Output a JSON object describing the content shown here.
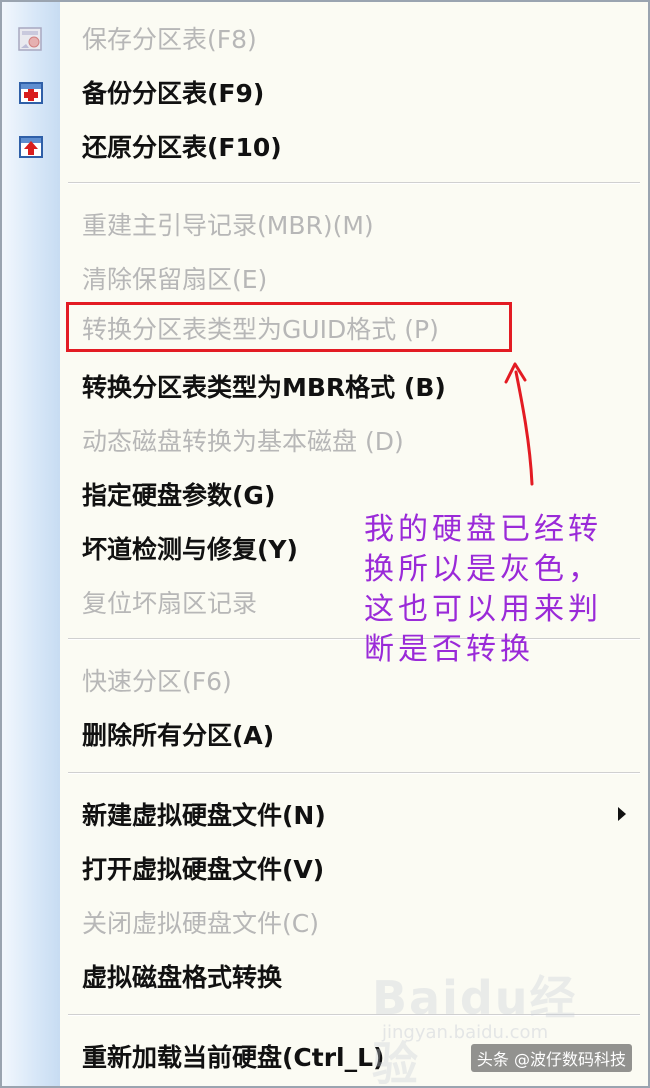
{
  "menu": {
    "items": [
      {
        "label": "保存分区表(F8)",
        "disabled": true
      },
      {
        "label": "备份分区表(F9)",
        "disabled": false
      },
      {
        "label": "还原分区表(F10)",
        "disabled": false
      },
      {
        "label": "重建主引导记录(MBR)(M)",
        "disabled": true
      },
      {
        "label": "清除保留扇区(E)",
        "disabled": true
      },
      {
        "label": "转换分区表类型为GUID格式 (P)",
        "disabled": true
      },
      {
        "label": "转换分区表类型为MBR格式 (B)",
        "disabled": false
      },
      {
        "label": "动态磁盘转换为基本磁盘 (D)",
        "disabled": true
      },
      {
        "label": "指定硬盘参数(G)",
        "disabled": false
      },
      {
        "label": "坏道检测与修复(Y)",
        "disabled": false
      },
      {
        "label": "复位坏扇区记录",
        "disabled": true
      },
      {
        "label": "快速分区(F6)",
        "disabled": true
      },
      {
        "label": "删除所有分区(A)",
        "disabled": false
      },
      {
        "label": "新建虚拟硬盘文件(N)",
        "disabled": false,
        "submenu": true
      },
      {
        "label": "打开虚拟硬盘文件(V)",
        "disabled": false
      },
      {
        "label": "关闭虚拟硬盘文件(C)",
        "disabled": true
      },
      {
        "label": "虚拟磁盘格式转换",
        "disabled": false
      },
      {
        "label": "重新加载当前硬盘(Ctrl_L)",
        "disabled": false
      }
    ]
  },
  "icons": {
    "save": "save-table-icon",
    "backup": "backup-table-icon",
    "restore": "restore-table-icon"
  },
  "annotation": {
    "text": "我的硬盘已经转换所以是灰色，这也可以用来判断是否转换",
    "color": "#9a2ad8"
  },
  "highlight_color": "#e31b23",
  "watermark": {
    "logo": "Baidu经验",
    "url": "jingyan.baidu.com"
  },
  "credit": "头条 @波仔数码科技"
}
